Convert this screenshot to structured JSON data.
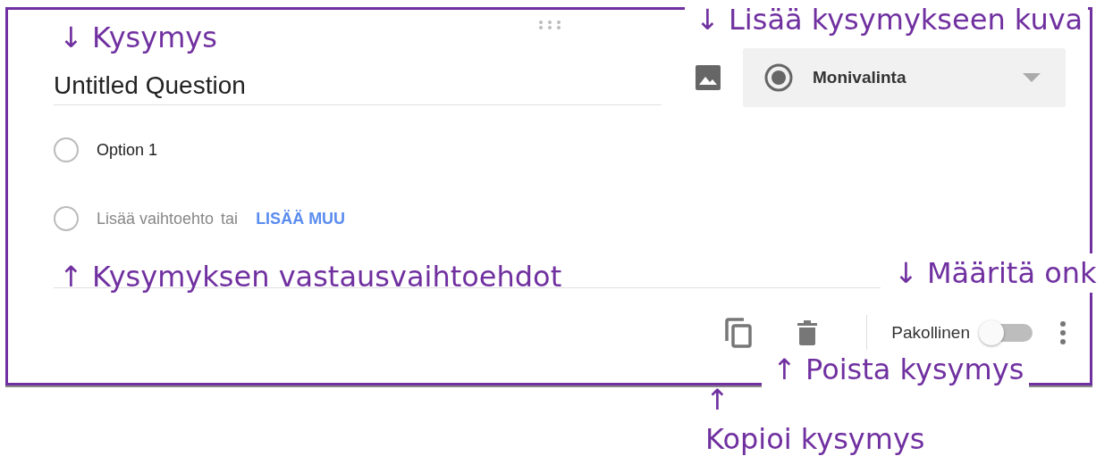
{
  "question": {
    "title": "Untitled Question"
  },
  "type_dropdown": {
    "value": "Monivalinta"
  },
  "options": [
    {
      "kind": "option",
      "label": "Option 1",
      "selected": false
    },
    {
      "kind": "add",
      "label": "Lisää vaihtoehto",
      "separator": "tai",
      "link": "LISÄÄ MUU",
      "selected": false
    }
  ],
  "footer": {
    "required_label": "Pakollinen",
    "required": false
  },
  "annotations": [
    {
      "text": "↓ Kysymys"
    },
    {
      "text": "↓ Lisää kysymykseen kuva"
    },
    {
      "text": "↑ Kysymyksen vastausvaihtoehdot"
    },
    {
      "text": "↓ Määritä onk"
    },
    {
      "text": "↑ Poista kysymys"
    },
    {
      "text": "↑"
    },
    {
      "text": "Kopioi kysymys"
    }
  ]
}
